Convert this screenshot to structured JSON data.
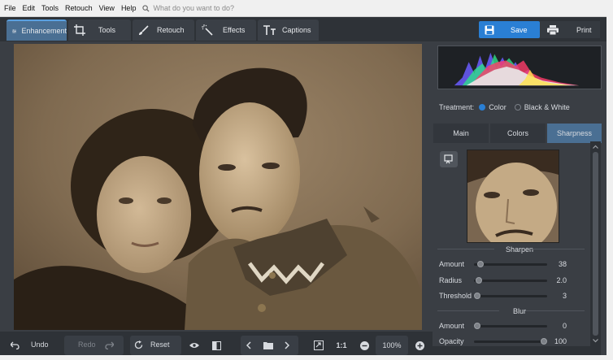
{
  "menu": [
    "File",
    "Edit",
    "Tools",
    "Retouch",
    "View",
    "Help"
  ],
  "search": {
    "placeholder": "What do you want to do?"
  },
  "tabs": [
    {
      "label": "Enhancement",
      "icon": "sliders-icon"
    },
    {
      "label": "Tools",
      "icon": "crop-icon"
    },
    {
      "label": "Retouch",
      "icon": "brush-icon"
    },
    {
      "label": "Effects",
      "icon": "magic-wand-icon"
    },
    {
      "label": "Captions",
      "icon": "text-icon"
    }
  ],
  "actions": {
    "save": "Save",
    "print": "Print"
  },
  "bottom": {
    "undo": "Undo",
    "redo": "Redo",
    "reset": "Reset",
    "ratio": "1:1",
    "zoom": "100%"
  },
  "treatment": {
    "label": "Treatment:",
    "options": [
      "Color",
      "Black & White"
    ],
    "selected": "Color"
  },
  "panel_tabs": [
    "Main",
    "Colors",
    "Sharpness"
  ],
  "panel_active_tab": "Sharpness",
  "sharpen": {
    "title": "Sharpen",
    "amount": {
      "label": "Amount",
      "value": 38
    },
    "radius": {
      "label": "Radius",
      "value": "2.0"
    },
    "threshold": {
      "label": "Threshold",
      "value": 3
    }
  },
  "blur": {
    "title": "Blur",
    "amount": {
      "label": "Amount",
      "value": 0
    },
    "opacity": {
      "label": "Opacity",
      "value": 100
    }
  },
  "colors": {
    "accent": "#2a7fd4",
    "active_tab": "#4a6f93",
    "bg": "#3a3e44",
    "toolbar": "#2e3237",
    "photo_sepia": "#8a7358"
  }
}
